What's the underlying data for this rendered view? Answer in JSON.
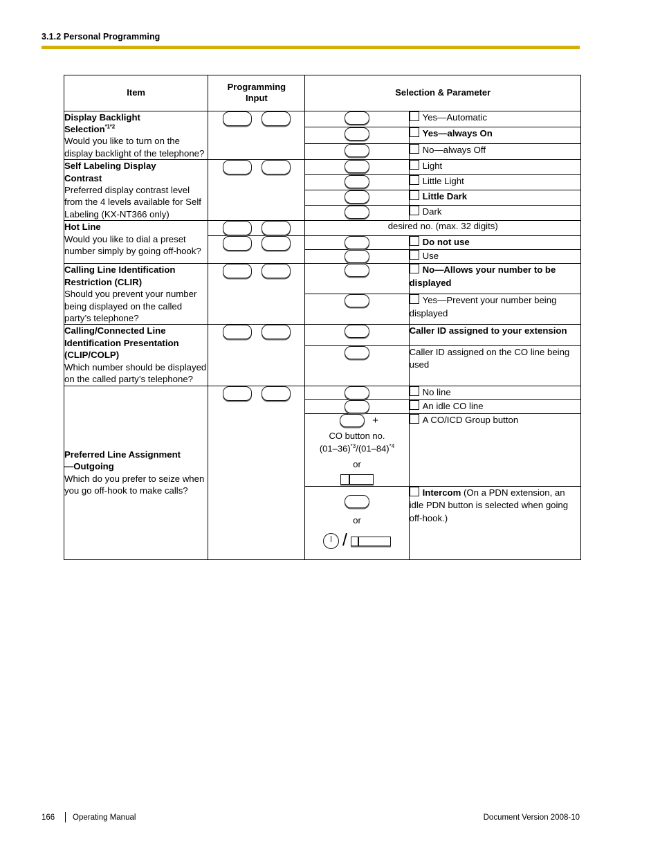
{
  "header": {
    "breadcrumb": "3.1.2 Personal Programming",
    "rule_color": "#d4af08"
  },
  "table": {
    "columns": {
      "item": "Item",
      "programming_input": "Programming\nInput",
      "programming_input_line1": "Programming",
      "programming_input_line2": "Input",
      "selection_parameter": "Selection & Parameter"
    },
    "rows": [
      {
        "id": "display-backlight-selection",
        "title": "Display Backlight Selection",
        "title_line1": "Display Backlight",
        "title_line2": "Selection",
        "footnotes": "*1*2",
        "description": "Would you like to turn on the display backlight of the telephone?",
        "options": [
          {
            "label": "Yes—Automatic",
            "bold": false,
            "checkbox": true
          },
          {
            "label": "Yes—always On",
            "bold": true,
            "checkbox": true
          },
          {
            "label": "No—always Off",
            "bold": false,
            "checkbox": true
          }
        ]
      },
      {
        "id": "self-labeling-display-contrast",
        "title": "Self Labeling Display Contrast",
        "title_line1": "Self Labeling Display",
        "title_line2": "Contrast",
        "description": "Preferred display contrast level from the 4 levels available for Self Labeling (KX-NT366 only)",
        "options": [
          {
            "label": "Light",
            "bold": false,
            "checkbox": true
          },
          {
            "label": "Little Light",
            "bold": false,
            "checkbox": true
          },
          {
            "label": "Little Dark",
            "bold": true,
            "checkbox": true
          },
          {
            "label": "Dark",
            "bold": false,
            "checkbox": true
          }
        ]
      },
      {
        "id": "hot-line",
        "title": "Hot Line",
        "description": "Would you like to dial a preset number simply by going off-hook?",
        "merged_first_row": "desired no. (max. 32 digits)",
        "options": [
          {
            "label": "Do not use",
            "bold": true,
            "checkbox": true
          },
          {
            "label": "Use",
            "bold": false,
            "checkbox": true
          }
        ]
      },
      {
        "id": "calling-line-identification-restriction",
        "title": "Calling Line Identification Restriction (CLIR)",
        "title_line1": "Calling Line Identification",
        "title_line2": "Restriction (CLIR)",
        "description": "Should you prevent your number being displayed on the called party’s telephone?",
        "options": [
          {
            "label": "No—Allows your number to be displayed",
            "bold": true,
            "checkbox": true
          },
          {
            "label": "Yes—Prevent your number being displayed",
            "bold": false,
            "checkbox": true
          }
        ]
      },
      {
        "id": "calling-connected-line-identification-presentation",
        "title": "Calling/Connected Line Identification Presentation (CLIP/COLP)",
        "title_line1": "Calling/Connected Line",
        "title_line2": "Identification Presentation",
        "title_line3": "(CLIP/COLP)",
        "description": "Which number should be displayed on the called party’s telephone?",
        "options": [
          {
            "label": "Caller ID assigned to your extension",
            "bold": true,
            "checkbox": false
          },
          {
            "label": "Caller ID assigned on the CO line being used",
            "bold": false,
            "checkbox": false
          }
        ]
      },
      {
        "id": "preferred-line-assignment-outgoing",
        "title": "Preferred Line Assignment—Outgoing",
        "title_line1": "Preferred Line Assignment",
        "title_line2": "—Outgoing",
        "description": "Which do you prefer to seize when you go off-hook to make calls?",
        "options": [
          {
            "label": "No line",
            "bold": false,
            "checkbox": true
          },
          {
            "label": "An idle CO line",
            "bold": false,
            "checkbox": true
          },
          {
            "label": "A CO/ICD Group button",
            "bold": false,
            "checkbox": true
          },
          {
            "label_bold_part": "Intercom",
            "label_rest": " (On a PDN extension, an idle PDN button is selected when going off-hook.)",
            "bold": false,
            "checkbox": true
          }
        ],
        "key_notes": {
          "co_button_label": "CO button no.",
          "co_button_range": "(01–36)*3/(01–84)*4",
          "co_button_range_a": "(01–36)",
          "co_button_range_sup_a": "*3",
          "co_button_range_sep": "/(01–84)",
          "co_button_range_sup_b": "*4",
          "or": "or",
          "plus": "+"
        }
      }
    ]
  },
  "footer": {
    "page_number": "166",
    "manual": "Operating Manual",
    "document_version": "Document Version  2008-10"
  }
}
